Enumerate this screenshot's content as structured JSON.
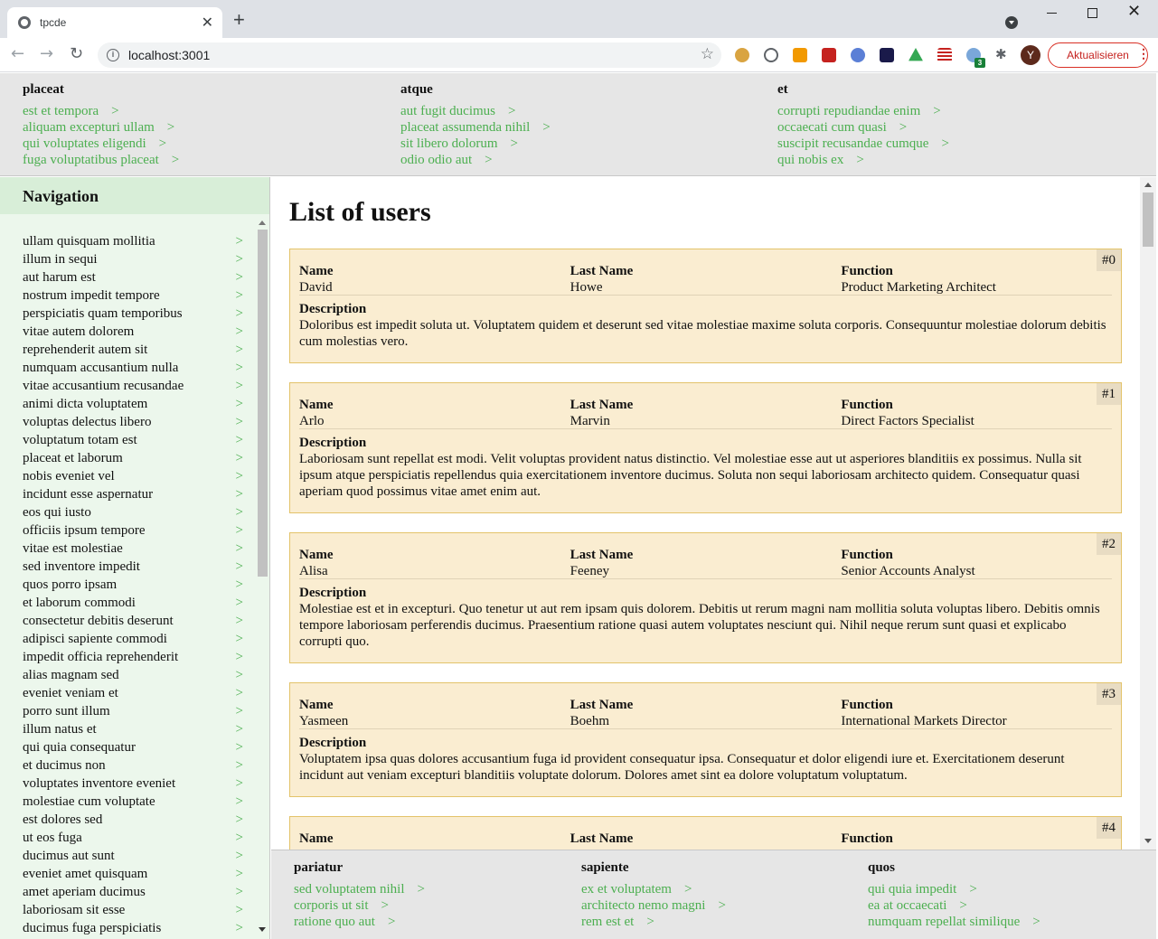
{
  "browser": {
    "tab_title": "tpcde",
    "tab_close": "✕",
    "new_tab": "+",
    "url": "localhost:3001",
    "profile_initial": "Y",
    "update_label": "Aktualisieren",
    "ext_badge": "3"
  },
  "header": {
    "columns": [
      {
        "title": "placeat",
        "links": [
          "est et tempora",
          "aliquam excepturi ullam",
          "qui voluptates eligendi",
          "fuga voluptatibus placeat"
        ]
      },
      {
        "title": "atque",
        "links": [
          "aut fugit ducimus",
          "placeat assumenda nihil",
          "sit libero dolorum",
          "odio odio aut"
        ]
      },
      {
        "title": "et",
        "links": [
          "corrupti repudiandae enim",
          "occaecati cum quasi",
          "suscipit recusandae cumque",
          "qui nobis ex"
        ]
      }
    ]
  },
  "link_arrow": ">",
  "sidebar": {
    "title": "Navigation",
    "items": [
      "ullam quisquam mollitia",
      "illum in sequi",
      "aut harum est",
      "nostrum impedit tempore",
      "perspiciatis quam temporibus",
      "vitae autem dolorem",
      "reprehenderit autem sit",
      "numquam accusantium nulla",
      "vitae accusantium recusandae",
      "animi dicta voluptatem",
      "voluptas delectus libero",
      "voluptatum totam est",
      "placeat et laborum",
      "nobis eveniet vel",
      "incidunt esse aspernatur",
      "eos qui iusto",
      "officiis ipsum tempore",
      "vitae est molestiae",
      "sed inventore impedit",
      "quos porro ipsam",
      "et laborum commodi",
      "consectetur debitis deserunt",
      "adipisci sapiente commodi",
      "impedit officia reprehenderit",
      "alias magnam sed",
      "eveniet veniam et",
      "porro sunt illum",
      "illum natus et",
      "qui quia consequatur",
      "et ducimus non",
      "voluptates inventore eveniet",
      "molestiae cum voluptate",
      "est dolores sed",
      "ut eos fuga",
      "ducimus aut sunt",
      "eveniet amet quisquam",
      "amet aperiam ducimus",
      "laboriosam sit esse",
      "ducimus fuga perspiciatis"
    ]
  },
  "main": {
    "title": "List of users",
    "labels": {
      "name": "Name",
      "last_name": "Last Name",
      "function": "Function",
      "description": "Description"
    },
    "users": [
      {
        "index": "#0",
        "name": "David",
        "last_name": "Howe",
        "function": "Product Marketing Architect",
        "description": "Doloribus est impedit soluta ut. Voluptatem quidem et deserunt sed vitae molestiae maxime soluta corporis. Consequuntur molestiae dolorum debitis cum molestias vero."
      },
      {
        "index": "#1",
        "name": "Arlo",
        "last_name": "Marvin",
        "function": "Direct Factors Specialist",
        "description": "Laboriosam sunt repellat est modi. Velit voluptas provident natus distinctio. Vel molestiae esse aut ut asperiores blanditiis ex possimus. Nulla sit ipsum atque perspiciatis repellendus quia exercitationem inventore ducimus. Soluta non sequi laboriosam architecto quidem. Consequatur quasi aperiam quod possimus vitae amet enim aut."
      },
      {
        "index": "#2",
        "name": "Alisa",
        "last_name": "Feeney",
        "function": "Senior Accounts Analyst",
        "description": "Molestiae est et in excepturi. Quo tenetur ut aut rem ipsam quis dolorem. Debitis ut rerum magni nam mollitia soluta voluptas libero. Debitis omnis tempore laboriosam perferendis ducimus. Praesentium ratione quasi autem voluptates nesciunt qui. Nihil neque rerum sunt quasi et explicabo corrupti quo."
      },
      {
        "index": "#3",
        "name": "Yasmeen",
        "last_name": "Boehm",
        "function": "International Markets Director",
        "description": "Voluptatem ipsa quas dolores accusantium fuga id provident consequatur ipsa. Consequatur et dolor eligendi iure et. Exercitationem deserunt incidunt aut veniam excepturi blanditiis voluptate dolorum. Dolores amet sint ea dolore voluptatum voluptatum."
      },
      {
        "index": "#4",
        "name": "",
        "last_name": "",
        "function": "",
        "description": ""
      }
    ]
  },
  "footer": {
    "columns": [
      {
        "title": "pariatur",
        "links": [
          "sed voluptatem nihil",
          "corporis ut sit",
          "ratione quo aut"
        ]
      },
      {
        "title": "sapiente",
        "links": [
          "ex et voluptatem",
          "architecto nemo magni",
          "rem est et"
        ]
      },
      {
        "title": "quos",
        "links": [
          "qui quia impedit",
          "ea at occaecati",
          "numquam repellat similique"
        ]
      }
    ]
  }
}
